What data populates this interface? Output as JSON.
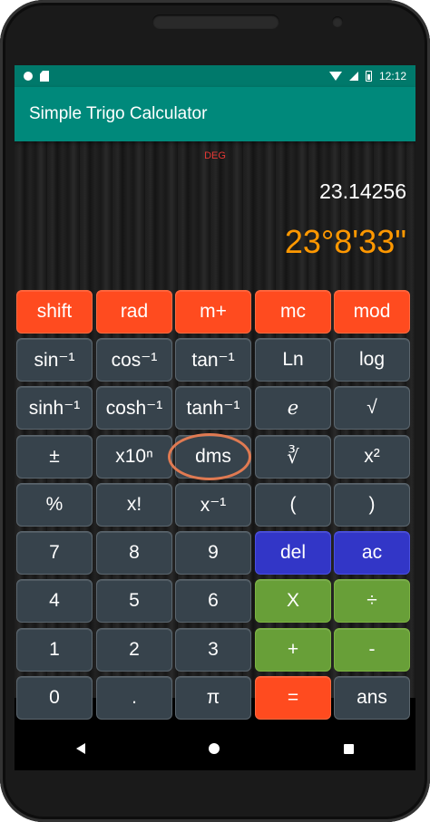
{
  "status": {
    "time": "12:12"
  },
  "appbar": {
    "title": "Simple Trigo Calculator"
  },
  "display": {
    "mode": "DEG",
    "decimal": "23.14256",
    "dms": "23°8'33\""
  },
  "keys": [
    [
      "shift",
      "rad",
      "m+",
      "mc",
      "mod"
    ],
    [
      "sin⁻¹",
      "cos⁻¹",
      "tan⁻¹",
      "Ln",
      "log"
    ],
    [
      "sinh⁻¹",
      "cosh⁻¹",
      "tanh⁻¹",
      "𝑒",
      "√"
    ],
    [
      "±",
      "x10ⁿ",
      "dms",
      "∛",
      "x²"
    ],
    [
      "%",
      "x!",
      "x⁻¹",
      "(",
      ")"
    ],
    [
      "7",
      "8",
      "9",
      "del",
      "ac"
    ],
    [
      "4",
      "5",
      "6",
      "X",
      "÷"
    ],
    [
      "1",
      "2",
      "3",
      "+",
      "-"
    ],
    [
      "0",
      ".",
      "π",
      "=",
      "ans"
    ]
  ],
  "colors": {
    "orange": "#ff4b1f",
    "blue": "#3236c7",
    "green": "#689f38",
    "teal": "#00897b",
    "display_orange": "#ff9800",
    "deg_red": "#e53935"
  },
  "icons": {
    "nav_back": "back-triangle-icon",
    "nav_home": "home-circle-icon",
    "nav_recent": "recent-square-icon"
  }
}
